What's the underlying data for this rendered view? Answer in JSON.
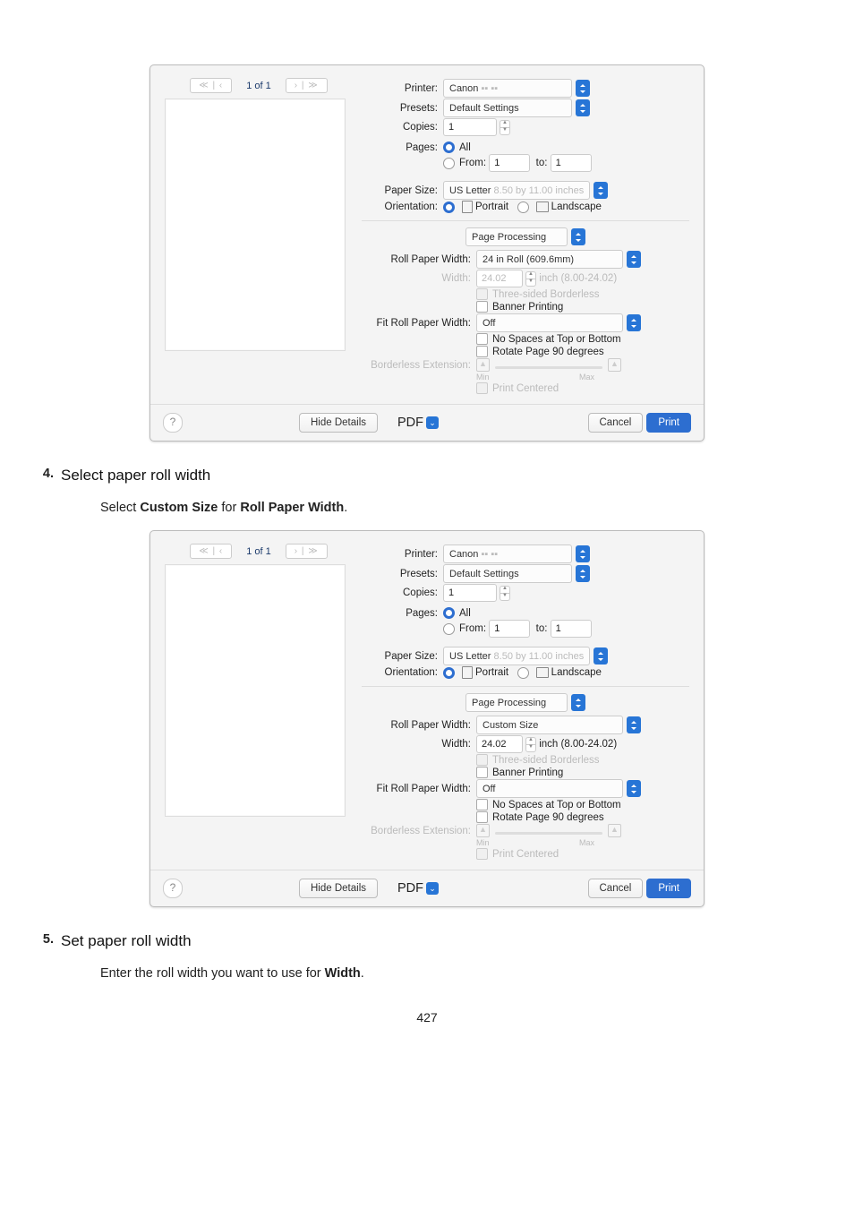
{
  "page_number": "427",
  "steps": {
    "s4": {
      "num": "4.",
      "title": "Select paper roll width",
      "body_pre": "Select ",
      "b1": "Custom Size",
      "mid": " for ",
      "b2": "Roll Paper Width",
      "post": "."
    },
    "s5": {
      "num": "5.",
      "title": "Set paper roll width",
      "body_pre": "Enter the roll width you want to use for ",
      "b1": "Width",
      "post": "."
    }
  },
  "dlg": {
    "nav_prev": "≪ | ‹",
    "page": "1 of 1",
    "nav_next": "› | ≫",
    "printer_l": "Printer:",
    "printer_v": "Canon",
    "presets_l": "Presets:",
    "presets_v": "Default Settings",
    "copies_l": "Copies:",
    "copies_v": "1",
    "pages_l": "Pages:",
    "all": "All",
    "from_l": "From:",
    "from_v": "1",
    "to_l": "to:",
    "to_v": "1",
    "paper_l": "Paper Size:",
    "paper_v": "US Letter",
    "paper_dim": "8.50 by 11.00 inches",
    "orient_l": "Orientation:",
    "portrait": "Portrait",
    "landscape": "Landscape",
    "section": "Page Processing",
    "rpw_l": "Roll Paper Width:",
    "rpw_v1": "24 in Roll (609.6mm)",
    "rpw_v2": "Custom Size",
    "width_l": "Width:",
    "width_v": "24.02",
    "width_u": "inch (8.00-24.02)",
    "three": "Three-sided Borderless",
    "banner": "Banner Printing",
    "frpw_l": "Fit Roll Paper Width:",
    "frpw_v": "Off",
    "nospace": "No Spaces at Top or Bottom",
    "rotate": "Rotate Page 90 degrees",
    "bext_l": "Borderless Extension:",
    "min": "Min",
    "max": "Max",
    "center": "Print Centered",
    "help": "?",
    "hide": "Hide Details",
    "pdf": "PDF",
    "cancel": "Cancel",
    "print": "Print"
  }
}
